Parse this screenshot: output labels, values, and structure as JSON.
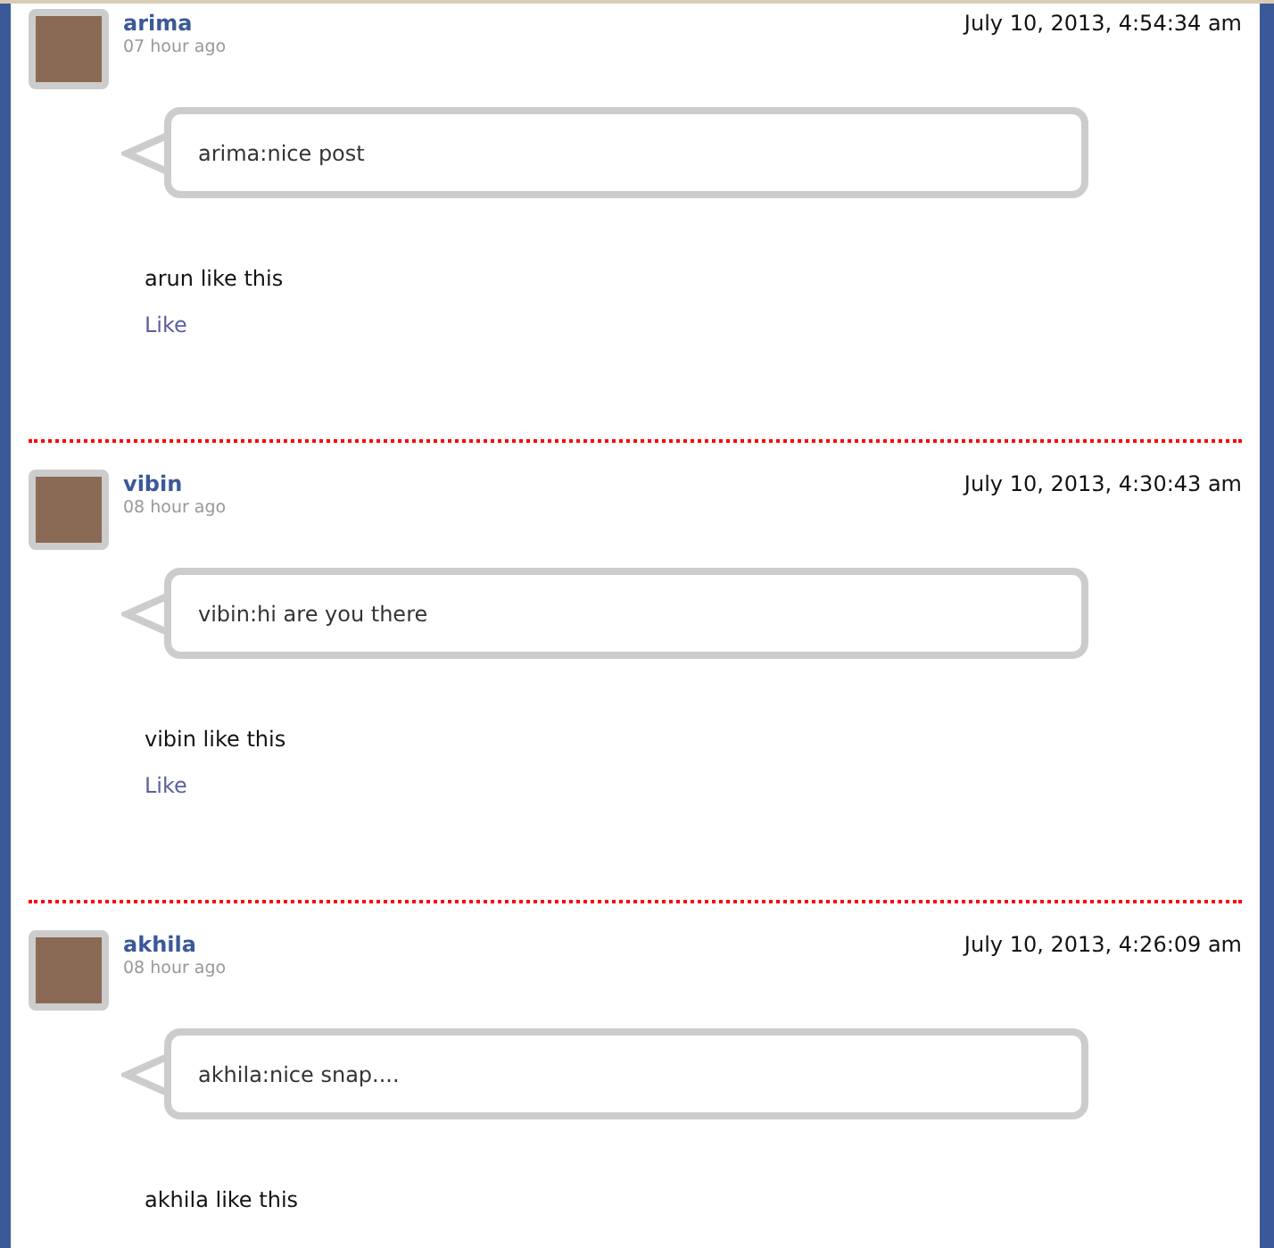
{
  "posts": [
    {
      "name": "arima",
      "ago": "07 hour ago",
      "date": "July 10, 2013, 4:54:34 am",
      "message": "arima:nice post",
      "likes_text": "arun like this",
      "like_link": "Like"
    },
    {
      "name": "vibin",
      "ago": "08 hour ago",
      "date": "July 10, 2013, 4:30:43 am",
      "message": "vibin:hi are you there",
      "likes_text": "vibin like this",
      "like_link": "Like"
    },
    {
      "name": "akhila",
      "ago": "08 hour ago",
      "date": "July 10, 2013, 4:26:09 am",
      "message": "akhila:nice snap....",
      "likes_text": "akhila like this"
    }
  ]
}
